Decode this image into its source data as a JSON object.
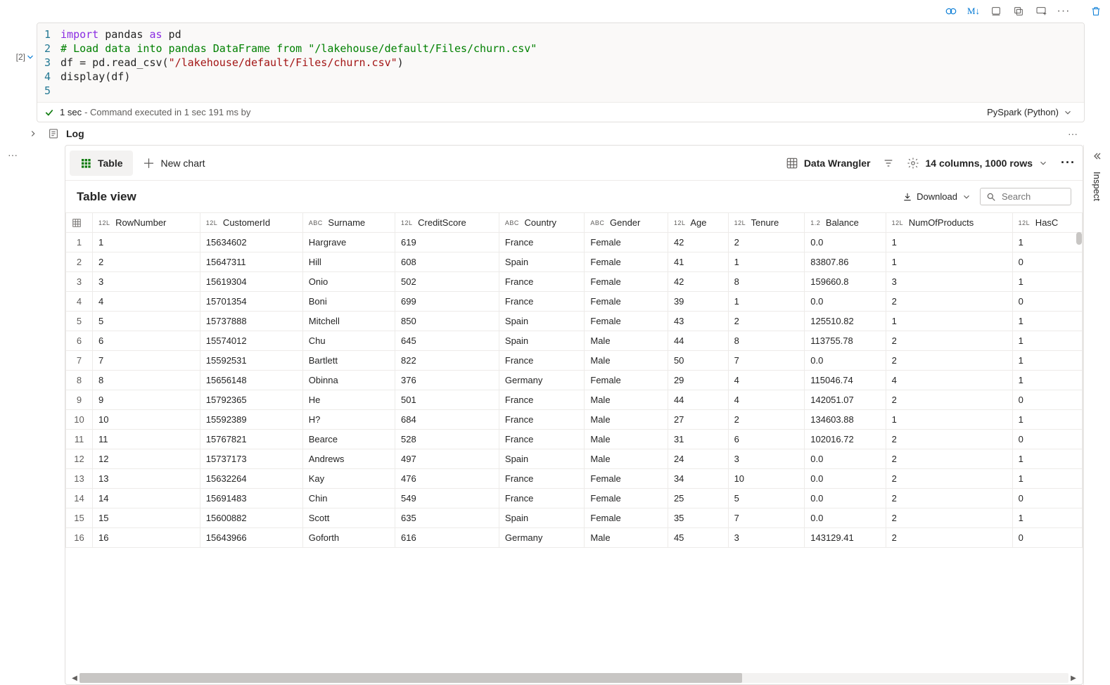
{
  "cell_index": "[2]",
  "code": {
    "lines": [
      "1",
      "2",
      "3",
      "4",
      "5"
    ],
    "tokens": [
      [
        {
          "t": "import",
          "c": "kw"
        },
        {
          "t": " pandas ",
          "c": ""
        },
        {
          "t": "as",
          "c": "kw"
        },
        {
          "t": " pd",
          "c": ""
        }
      ],
      [
        {
          "t": "# Load data into pandas DataFrame from \"/lakehouse/default/Files/churn.csv\"",
          "c": "cmt"
        }
      ],
      [
        {
          "t": "df = pd.read_csv(",
          "c": ""
        },
        {
          "t": "\"/lakehouse/default/Files/churn.csv\"",
          "c": "str"
        },
        {
          "t": ")",
          "c": ""
        }
      ],
      [
        {
          "t": "display(df)",
          "c": ""
        }
      ],
      [
        {
          "t": "",
          "c": ""
        }
      ]
    ]
  },
  "status": {
    "duration": "1 sec",
    "meta": "- Command executed in 1 sec 191 ms by",
    "engine": "PySpark (Python)"
  },
  "toolbar_md": "M↓",
  "log": {
    "label": "Log"
  },
  "output": {
    "table_tab": "Table",
    "new_chart": "New chart",
    "wrangler": "Data Wrangler",
    "summary": "14 columns, 1000 rows",
    "view_title": "Table view",
    "download": "Download",
    "search_placeholder": "Search",
    "inspect": "Inspect"
  },
  "columns": [
    {
      "type": "",
      "name": ""
    },
    {
      "type": "12L",
      "name": "RowNumber"
    },
    {
      "type": "12L",
      "name": "CustomerId"
    },
    {
      "type": "ABC",
      "name": "Surname"
    },
    {
      "type": "12L",
      "name": "CreditScore"
    },
    {
      "type": "ABC",
      "name": "Country"
    },
    {
      "type": "ABC",
      "name": "Gender"
    },
    {
      "type": "12L",
      "name": "Age"
    },
    {
      "type": "12L",
      "name": "Tenure"
    },
    {
      "type": "1.2",
      "name": "Balance"
    },
    {
      "type": "12L",
      "name": "NumOfProducts"
    },
    {
      "type": "12L",
      "name": "HasC"
    }
  ],
  "rows": [
    [
      "1",
      "1",
      "15634602",
      "Hargrave",
      "619",
      "France",
      "Female",
      "42",
      "2",
      "0.0",
      "1",
      "1"
    ],
    [
      "2",
      "2",
      "15647311",
      "Hill",
      "608",
      "Spain",
      "Female",
      "41",
      "1",
      "83807.86",
      "1",
      "0"
    ],
    [
      "3",
      "3",
      "15619304",
      "Onio",
      "502",
      "France",
      "Female",
      "42",
      "8",
      "159660.8",
      "3",
      "1"
    ],
    [
      "4",
      "4",
      "15701354",
      "Boni",
      "699",
      "France",
      "Female",
      "39",
      "1",
      "0.0",
      "2",
      "0"
    ],
    [
      "5",
      "5",
      "15737888",
      "Mitchell",
      "850",
      "Spain",
      "Female",
      "43",
      "2",
      "125510.82",
      "1",
      "1"
    ],
    [
      "6",
      "6",
      "15574012",
      "Chu",
      "645",
      "Spain",
      "Male",
      "44",
      "8",
      "113755.78",
      "2",
      "1"
    ],
    [
      "7",
      "7",
      "15592531",
      "Bartlett",
      "822",
      "France",
      "Male",
      "50",
      "7",
      "0.0",
      "2",
      "1"
    ],
    [
      "8",
      "8",
      "15656148",
      "Obinna",
      "376",
      "Germany",
      "Female",
      "29",
      "4",
      "115046.74",
      "4",
      "1"
    ],
    [
      "9",
      "9",
      "15792365",
      "He",
      "501",
      "France",
      "Male",
      "44",
      "4",
      "142051.07",
      "2",
      "0"
    ],
    [
      "10",
      "10",
      "15592389",
      "H?",
      "684",
      "France",
      "Male",
      "27",
      "2",
      "134603.88",
      "1",
      "1"
    ],
    [
      "11",
      "11",
      "15767821",
      "Bearce",
      "528",
      "France",
      "Male",
      "31",
      "6",
      "102016.72",
      "2",
      "0"
    ],
    [
      "12",
      "12",
      "15737173",
      "Andrews",
      "497",
      "Spain",
      "Male",
      "24",
      "3",
      "0.0",
      "2",
      "1"
    ],
    [
      "13",
      "13",
      "15632264",
      "Kay",
      "476",
      "France",
      "Female",
      "34",
      "10",
      "0.0",
      "2",
      "1"
    ],
    [
      "14",
      "14",
      "15691483",
      "Chin",
      "549",
      "France",
      "Female",
      "25",
      "5",
      "0.0",
      "2",
      "0"
    ],
    [
      "15",
      "15",
      "15600882",
      "Scott",
      "635",
      "Spain",
      "Female",
      "35",
      "7",
      "0.0",
      "2",
      "1"
    ],
    [
      "16",
      "16",
      "15643966",
      "Goforth",
      "616",
      "Germany",
      "Male",
      "45",
      "3",
      "143129.41",
      "2",
      "0"
    ]
  ]
}
